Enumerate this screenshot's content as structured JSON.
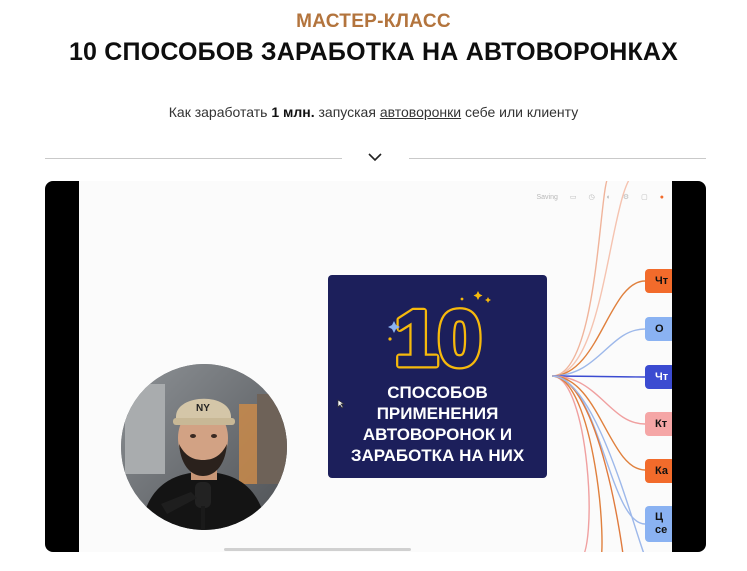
{
  "header": {
    "eyebrow": "МАСТЕР-КЛАСС",
    "title": "10 СПОСОБОВ ЗАРАБОТКА НА АВТОВОРОНКАХ",
    "subtitle_prefix": "Как заработать ",
    "subtitle_bold": "1 млн.",
    "subtitle_mid": " запуская ",
    "subtitle_link": "автоворонки",
    "subtitle_suffix": " себе или клиенту"
  },
  "video": {
    "toolbar_label": "Saving",
    "card": {
      "number": "10",
      "lines": [
        "СПОСОБОВ",
        "ПРИМЕНЕНИЯ",
        "АВТОВОРОНОК И",
        "ЗАРАБОТКА НА НИХ"
      ]
    },
    "tags": [
      {
        "text": "Чт",
        "color": "#f26b2b"
      },
      {
        "text": "О",
        "color": "#8ab2f2"
      },
      {
        "text": "Чт",
        "color": "#3b4bd1"
      },
      {
        "text": "Кт",
        "color": "#f5a6a6"
      },
      {
        "text": "Ка",
        "color": "#f26b2b"
      },
      {
        "text": "Ц",
        "color": "#8ab2f2",
        "text2": "се"
      }
    ],
    "cap_logo": "NY"
  }
}
